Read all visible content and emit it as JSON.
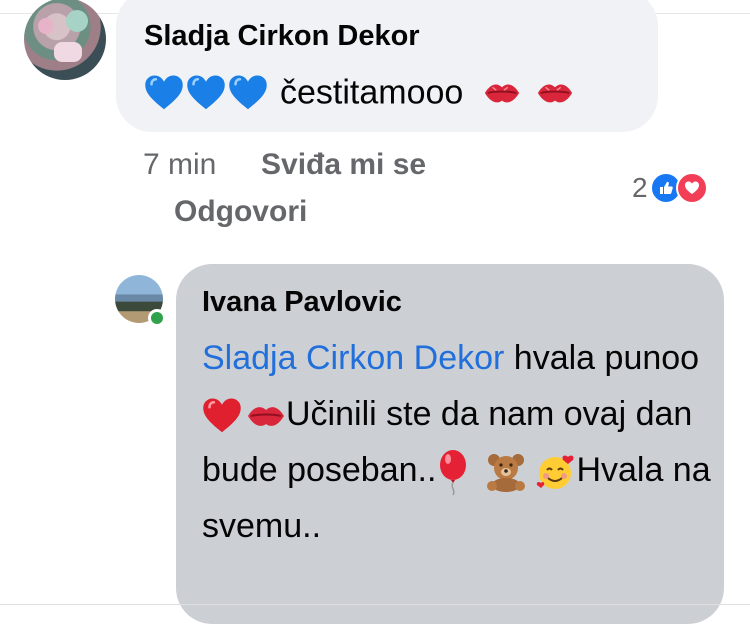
{
  "comment1": {
    "author": "Sladja Cirkon Dekor",
    "text": "čestitamooo",
    "emoji_prefix": [
      "blue-heart-icon",
      "blue-heart-icon",
      "blue-heart-icon"
    ],
    "emoji_suffix": [
      "kiss-mark-icon",
      "kiss-mark-icon"
    ],
    "time": "7 min",
    "like_label": "Sviđa mi se",
    "reply_label": "Odgovori",
    "reaction_count": "2",
    "reaction_icons": [
      "like-reaction-icon",
      "love-reaction-icon"
    ]
  },
  "reply1": {
    "author": "Ivana Pavlovic",
    "mention": "Sladja Cirkon Dekor",
    "text_part1": " hvala punoo ",
    "text_part2": "Učinili ste da nam ovaj dan bude poseban..",
    "text_part3": "Hvala na svemu..",
    "online": true
  },
  "colors": {
    "bubble_gray": "#f0f2f5",
    "reply_bubble": "#ccd0d5",
    "mention_blue": "#216fdb",
    "secondary_text": "#65676b",
    "like_blue": "#1877f2",
    "love_red": "#f33e58",
    "online_green": "#31a24c"
  }
}
